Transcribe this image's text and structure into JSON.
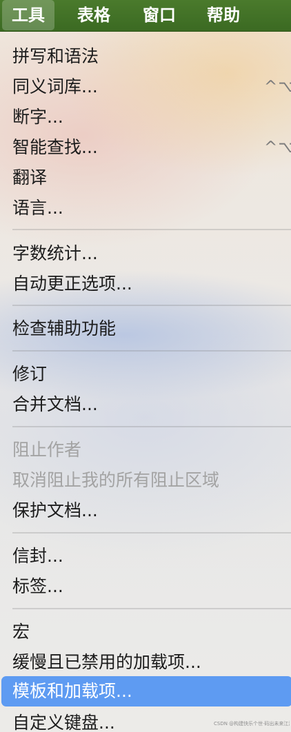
{
  "menubar": {
    "items": [
      {
        "label": "工具",
        "active": true
      },
      {
        "label": "表格",
        "active": false
      },
      {
        "label": "窗口",
        "active": false
      },
      {
        "label": "帮助",
        "active": false
      }
    ]
  },
  "menu": {
    "groups": [
      [
        {
          "label": "拼写和语法"
        },
        {
          "label": "同义词库...",
          "shortcut": "^⌥"
        },
        {
          "label": "断字..."
        },
        {
          "label": "智能查找...",
          "shortcut": "^⌥"
        },
        {
          "label": "翻译"
        },
        {
          "label": "语言..."
        }
      ],
      [
        {
          "label": "字数统计..."
        },
        {
          "label": "自动更正选项..."
        }
      ],
      [
        {
          "label": "检查辅助功能"
        }
      ],
      [
        {
          "label": "修订"
        },
        {
          "label": "合并文档..."
        }
      ],
      [
        {
          "label": "阻止作者",
          "disabled": true
        },
        {
          "label": "取消阻止我的所有阻止区域",
          "disabled": true
        },
        {
          "label": "保护文档..."
        }
      ],
      [
        {
          "label": "信封..."
        },
        {
          "label": "标签..."
        }
      ],
      [
        {
          "label": "宏"
        },
        {
          "label": "缓慢且已禁用的加载项..."
        },
        {
          "label": "模板和加载项...",
          "highlighted": true
        },
        {
          "label": "自定义键盘..."
        }
      ]
    ]
  },
  "watermark": "CSDN @构建快乐个世·码出未来江湖"
}
